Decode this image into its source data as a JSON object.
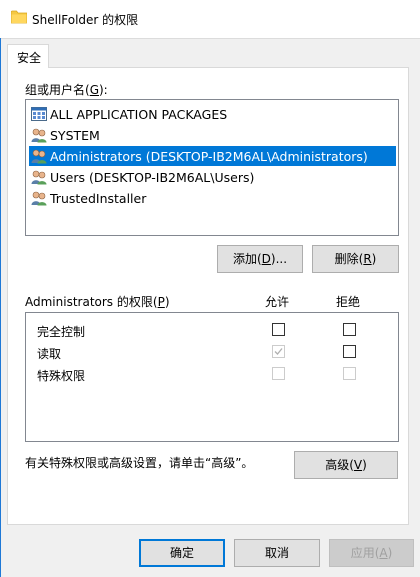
{
  "window": {
    "title": "ShellFolder 的权限"
  },
  "tabs": [
    {
      "label": "安全"
    }
  ],
  "groups": {
    "label_prefix": "组或用户名(",
    "label_key": "G",
    "label_suffix": "):",
    "items": [
      {
        "name": "ALL APPLICATION PACKAGES",
        "icon": "app-packages-icon",
        "selected": false
      },
      {
        "name": "SYSTEM",
        "icon": "users-group-icon",
        "selected": false
      },
      {
        "name": "Administrators (DESKTOP-IB2M6AL\\Administrators)",
        "icon": "users-group-icon",
        "selected": true
      },
      {
        "name": "Users (DESKTOP-IB2M6AL\\Users)",
        "icon": "users-group-icon",
        "selected": false
      },
      {
        "name": "TrustedInstaller",
        "icon": "users-group-icon",
        "selected": false
      }
    ]
  },
  "buttons": {
    "add": {
      "prefix": "添加(",
      "key": "D",
      "suffix": ")..."
    },
    "remove": {
      "prefix": "删除(",
      "key": "R",
      "suffix": ")"
    },
    "advanced": {
      "prefix": "高级(",
      "key": "V",
      "suffix": ")"
    },
    "ok": "确定",
    "cancel": "取消",
    "apply": {
      "prefix": "应用(",
      "key": "A",
      "suffix": ")"
    }
  },
  "permissions": {
    "label_prefix": "Administrators 的权限(",
    "label_key": "P",
    "label_suffix": ")",
    "allow_header": "允许",
    "deny_header": "拒绝",
    "rows": [
      {
        "name": "完全控制",
        "allow": false,
        "deny": false,
        "allow_disabled": false,
        "deny_disabled": false
      },
      {
        "name": "读取",
        "allow": true,
        "deny": false,
        "allow_disabled": true,
        "deny_disabled": false
      },
      {
        "name": "特殊权限",
        "allow": false,
        "deny": false,
        "allow_disabled": true,
        "deny_disabled": true
      }
    ]
  },
  "advanced_hint": "有关特殊权限或高级设置，请单击“高级”。",
  "colors": {
    "selection": "#0078d7",
    "default_button_border": "#0078d7",
    "window_edge": "#1e78d6"
  }
}
